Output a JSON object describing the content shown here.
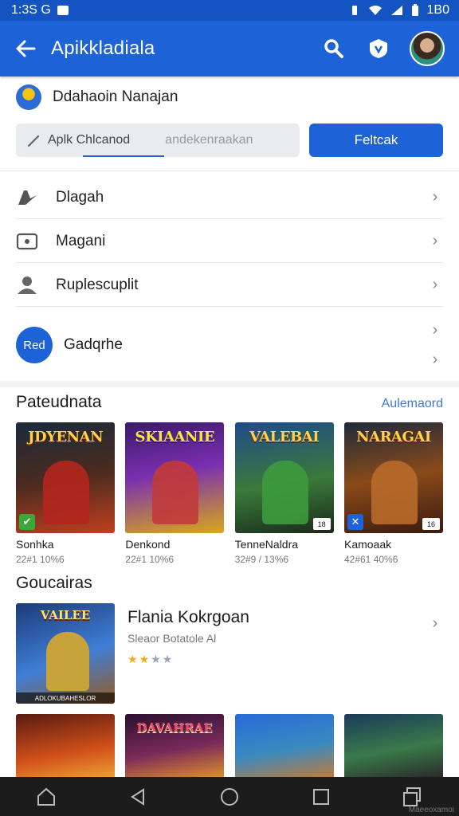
{
  "status_bar": {
    "time": "1:3S G",
    "right_text": "1B0"
  },
  "app_bar": {
    "title": "Apikkladiala"
  },
  "profile": {
    "name": "Ddahaoin Nanajan"
  },
  "search": {
    "value": "Aplk Chlcanod",
    "hint": "andekenraakan",
    "button_label": "Feltcak"
  },
  "menu": {
    "items": [
      {
        "label": "Dlagah",
        "icon": "edit-pen-icon"
      },
      {
        "label": "Magani",
        "icon": "media-box-icon"
      },
      {
        "label": "Ruplescuplit",
        "icon": "user-group-icon"
      }
    ],
    "gadget": {
      "badge": "Red",
      "label": "Gadqrhe"
    }
  },
  "section_popular": {
    "title": "Pateudnata",
    "link": "Aulemaord",
    "games": [
      {
        "art_title": "JDYENAN",
        "name": "Sonhka",
        "meta": "22#1 10%6",
        "badge": "✔",
        "rating": ""
      },
      {
        "art_title": "SKIAANIE",
        "name": "Denkond",
        "meta": "22#1 10%6",
        "badge": "",
        "rating": ""
      },
      {
        "art_title": "VALEBAI",
        "name": "TenneNaldra",
        "meta": "32#9 / 13%6",
        "badge": "",
        "rating": "18"
      },
      {
        "art_title": "NARAGAI",
        "name": "Kamoaak",
        "meta": "42#61 40%6",
        "badge": "✕",
        "rating": "16"
      }
    ]
  },
  "section_games": {
    "title": "Goucairas",
    "featured": {
      "art_title": "VAILEE",
      "art_caption": "ADLOKUBAHESLOR",
      "title": "Flania Kokrgoan",
      "subtitle": "Sleaor Botatole Al",
      "stars": [
        "★",
        "★",
        "★",
        "★"
      ]
    },
    "bottom_titles": [
      "",
      "DAVAHRAE",
      "",
      ""
    ]
  },
  "navbar": {
    "watermark": "Maeeoxamoi"
  },
  "colors": {
    "primary": "#1e62d8",
    "status": "#1453c2",
    "link": "#3d78d8",
    "nav": "#1c1c1c"
  }
}
